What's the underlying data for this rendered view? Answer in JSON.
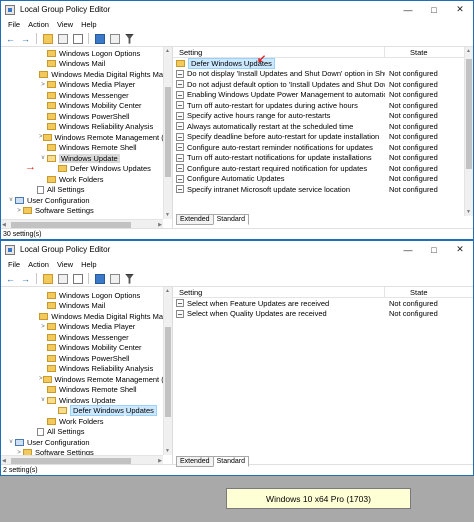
{
  "window1": {
    "title": "Local Group Policy Editor",
    "menu": [
      "File",
      "Action",
      "View",
      "Help"
    ],
    "tree": [
      {
        "label": "Windows Logon Options",
        "icon": "folder",
        "expand": ""
      },
      {
        "label": "Windows Mail",
        "icon": "folder",
        "expand": ""
      },
      {
        "label": "Windows Media Digital Rights Ma",
        "icon": "folder",
        "expand": ""
      },
      {
        "label": "Windows Media Player",
        "icon": "folder",
        "expand": ">"
      },
      {
        "label": "Windows Messenger",
        "icon": "folder",
        "expand": ""
      },
      {
        "label": "Windows Mobility Center",
        "icon": "folder",
        "expand": ""
      },
      {
        "label": "Windows PowerShell",
        "icon": "folder",
        "expand": ""
      },
      {
        "label": "Windows Reliability Analysis",
        "icon": "folder",
        "expand": ""
      },
      {
        "label": "Windows Remote Management (W",
        "icon": "folder",
        "expand": ">"
      },
      {
        "label": "Windows Remote Shell",
        "icon": "folder",
        "expand": ""
      },
      {
        "label": "Windows Update",
        "icon": "folder-open",
        "expand": "v"
      },
      {
        "label": "Defer Windows Updates",
        "icon": "folder",
        "expand": ""
      },
      {
        "label": "Work Folders",
        "icon": "folder",
        "expand": ""
      },
      {
        "label": "All Settings",
        "icon": "doc",
        "expand": ""
      },
      {
        "label": "User Configuration",
        "icon": "pc",
        "expand": "v"
      },
      {
        "label": "Software Settings",
        "icon": "folder",
        "expand": ">"
      }
    ],
    "columns": {
      "setting": "Setting",
      "state": "State"
    },
    "rows": [
      {
        "name": "Defer Windows Updates",
        "state": "",
        "icon": "folder"
      },
      {
        "name": "Do not display 'Install Updates and Shut Down' option in Shut ...",
        "state": "Not configured",
        "icon": "setting"
      },
      {
        "name": "Do not adjust default option to 'Install Updates and Shut Down'...",
        "state": "Not configured",
        "icon": "setting"
      },
      {
        "name": "Enabling Windows Update Power Management to automaticall...",
        "state": "Not configured",
        "icon": "setting"
      },
      {
        "name": "Turn off auto-restart for updates during active hours",
        "state": "Not configured",
        "icon": "setting"
      },
      {
        "name": "Specify active hours range for auto-restarts",
        "state": "Not configured",
        "icon": "setting"
      },
      {
        "name": "Always automatically restart at the scheduled time",
        "state": "Not configured",
        "icon": "setting"
      },
      {
        "name": "Specify deadline before auto-restart for update installation",
        "state": "Not configured",
        "icon": "setting"
      },
      {
        "name": "Configure auto-restart reminder notifications for updates",
        "state": "Not configured",
        "icon": "setting"
      },
      {
        "name": "Turn off auto-restart notifications for update installations",
        "state": "Not configured",
        "icon": "setting"
      },
      {
        "name": "Configure auto-restart required notification for updates",
        "state": "Not configured",
        "icon": "setting"
      },
      {
        "name": "Configure Automatic Updates",
        "state": "Not configured",
        "icon": "setting"
      },
      {
        "name": "Specify intranet Microsoft update service location",
        "state": "Not configured",
        "icon": "setting"
      }
    ],
    "tabs": [
      "Extended",
      "Standard"
    ],
    "status": "30 setting(s)"
  },
  "window2": {
    "title": "Local Group Policy Editor",
    "menu": [
      "File",
      "Action",
      "View",
      "Help"
    ],
    "tree": [
      {
        "label": "Windows Logon Options",
        "icon": "folder",
        "expand": ""
      },
      {
        "label": "Windows Mail",
        "icon": "folder",
        "expand": ""
      },
      {
        "label": "Windows Media Digital Rights Ma",
        "icon": "folder",
        "expand": ""
      },
      {
        "label": "Windows Media Player",
        "icon": "folder",
        "expand": ">"
      },
      {
        "label": "Windows Messenger",
        "icon": "folder",
        "expand": ""
      },
      {
        "label": "Windows Mobility Center",
        "icon": "folder",
        "expand": ""
      },
      {
        "label": "Windows PowerShell",
        "icon": "folder",
        "expand": ""
      },
      {
        "label": "Windows Reliability Analysis",
        "icon": "folder",
        "expand": ""
      },
      {
        "label": "Windows Remote Management (W",
        "icon": "folder",
        "expand": ">"
      },
      {
        "label": "Windows Remote Shell",
        "icon": "folder",
        "expand": ""
      },
      {
        "label": "Windows Update",
        "icon": "folder-open",
        "expand": "v"
      },
      {
        "label": "Defer Windows Updates",
        "icon": "folder-open",
        "expand": ""
      },
      {
        "label": "Work Folders",
        "icon": "folder",
        "expand": ""
      },
      {
        "label": "All Settings",
        "icon": "doc",
        "expand": ""
      },
      {
        "label": "User Configuration",
        "icon": "pc",
        "expand": "v"
      },
      {
        "label": "Software Settings",
        "icon": "folder",
        "expand": ">"
      }
    ],
    "columns": {
      "setting": "Setting",
      "state": "State"
    },
    "rows": [
      {
        "name": "Select when Feature Updates are received",
        "state": "Not configured",
        "icon": "setting"
      },
      {
        "name": "Select when Quality Updates are received",
        "state": "Not configured",
        "icon": "setting"
      }
    ],
    "tabs": [
      "Extended",
      "Standard"
    ],
    "status": "2 setting(s)"
  },
  "caption": "Windows 10 x64 Pro (1703)",
  "colors": {
    "title_border": "#1e6fb8",
    "selection": "#cce8ff",
    "annotation_arrow": "#e02020",
    "caption_bg": "#ffffd5",
    "backdrop": "#a9a9a9"
  },
  "icons": {
    "back": "back-arrow-icon",
    "forward": "forward-arrow-icon",
    "close": "close-icon",
    "minimize": "minimize-icon",
    "maximize": "maximize-icon"
  }
}
